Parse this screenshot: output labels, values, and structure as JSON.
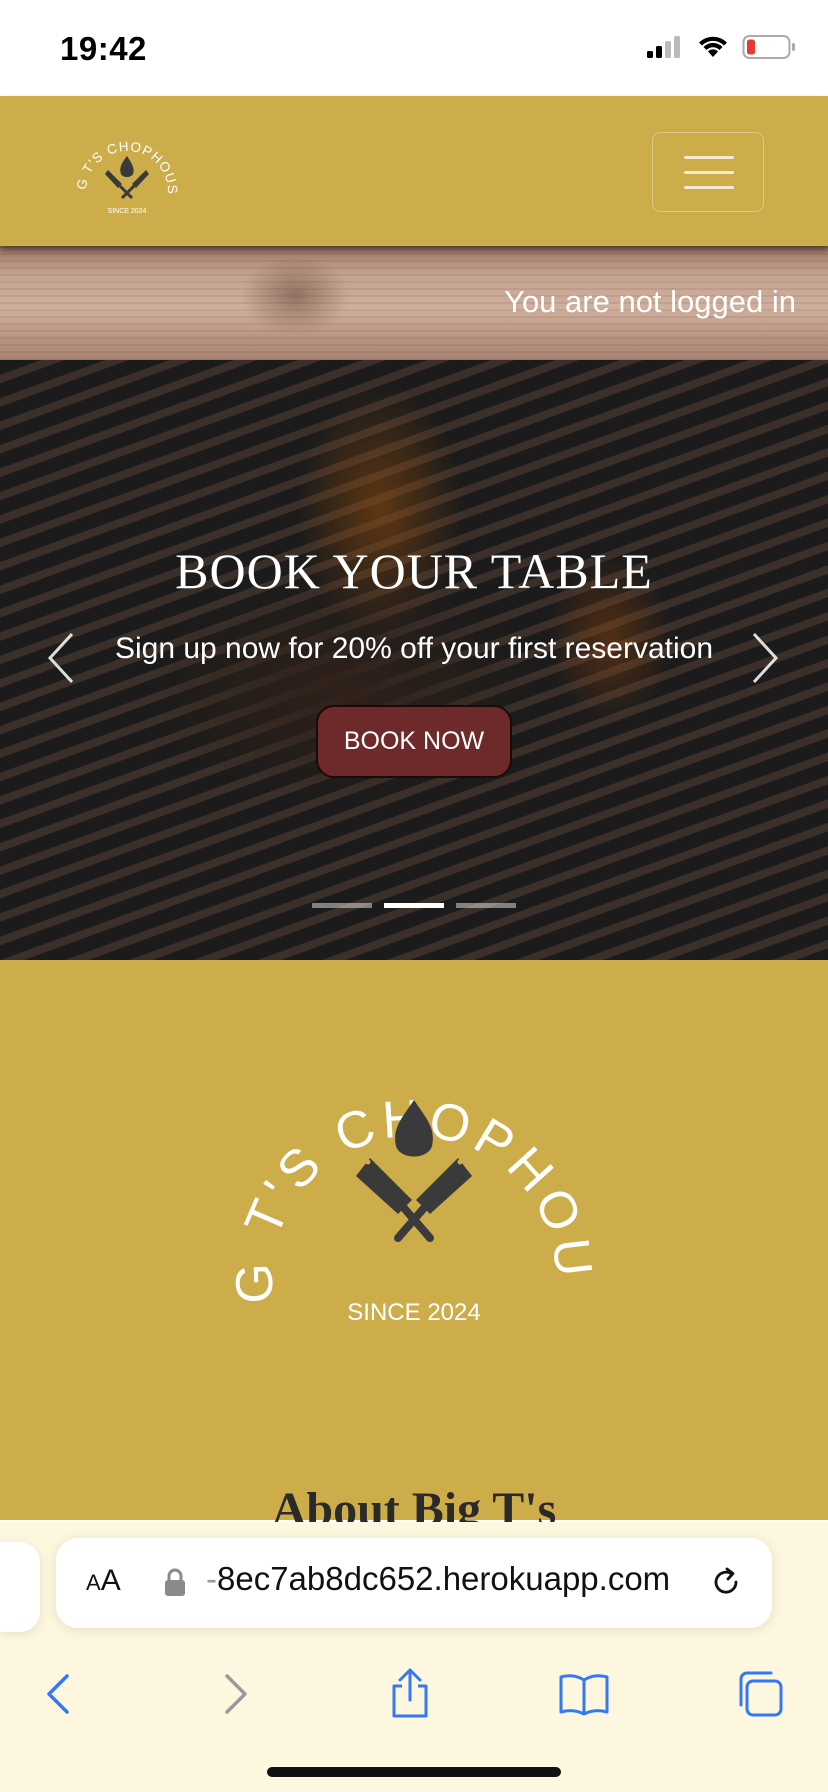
{
  "status_bar": {
    "time": "19:42",
    "icons": [
      "cellular-signal-icon",
      "wifi-icon",
      "battery-low-icon"
    ]
  },
  "navbar": {
    "logo": {
      "arc_text": "BIG T'S CHOPHOUSE",
      "since_text": "SINCE 2024",
      "icon": "flame-crossed-cleavers-icon"
    },
    "toggle_icon": "hamburger-menu-icon"
  },
  "login_status": "You are not logged in",
  "carousel": {
    "title": "BOOK YOUR TABLE",
    "subtitle": "Sign up now for 20% off your first reservation",
    "button_label": "BOOK NOW",
    "slide_count": 3,
    "active_slide": 2,
    "prev_icon": "chevron-left-icon",
    "next_icon": "chevron-right-icon"
  },
  "main_logo": {
    "arc_text": "BIG T'S CHOPHOUSE",
    "since_text": "SINCE 2024",
    "icon": "flame-crossed-cleavers-icon"
  },
  "about": {
    "heading": "About Big T's"
  },
  "browser": {
    "aa_label_small": "A",
    "aa_label_large": "A",
    "url_prefix": "-",
    "url": "8ec7ab8dc652.herokuapp.com",
    "toolbar_icons": [
      "back-icon",
      "forward-icon",
      "share-icon",
      "bookmarks-icon",
      "tabs-icon"
    ]
  },
  "colors": {
    "gold": "#cdad4a",
    "burgundy_button": "#6e2a2b",
    "charcoal": "#3a3a3a",
    "ios_blue": "#3478f6"
  }
}
